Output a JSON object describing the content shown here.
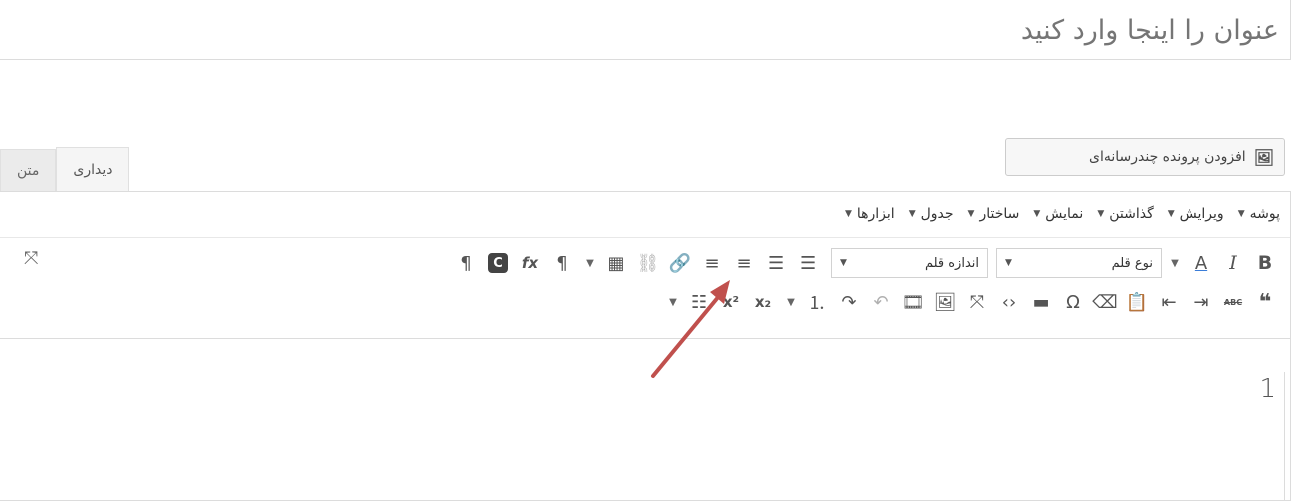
{
  "title": {
    "placeholder": "عنوان را اینجا وارد کنید"
  },
  "media_button": {
    "label": "افزودن پرونده چندرسانه‌ای",
    "icon": "add-media-icon"
  },
  "tabs": [
    {
      "label": "دیداری",
      "active": true
    },
    {
      "label": "متن",
      "active": false
    }
  ],
  "menubar": [
    "پوشه",
    "ویرایش",
    "گذاشتن",
    "نمایش",
    "ساختار",
    "جدول",
    "ابزارها"
  ],
  "toolbar": {
    "bold": "B",
    "italic": "I",
    "font_color": "A",
    "font_family": "نوع قلم",
    "font_size": "اندازه قلم",
    "fx": "fx"
  },
  "content": {
    "line1": "1"
  },
  "colors": {
    "accent_arrow": "#c0504d",
    "border": "#dcdcdc"
  }
}
